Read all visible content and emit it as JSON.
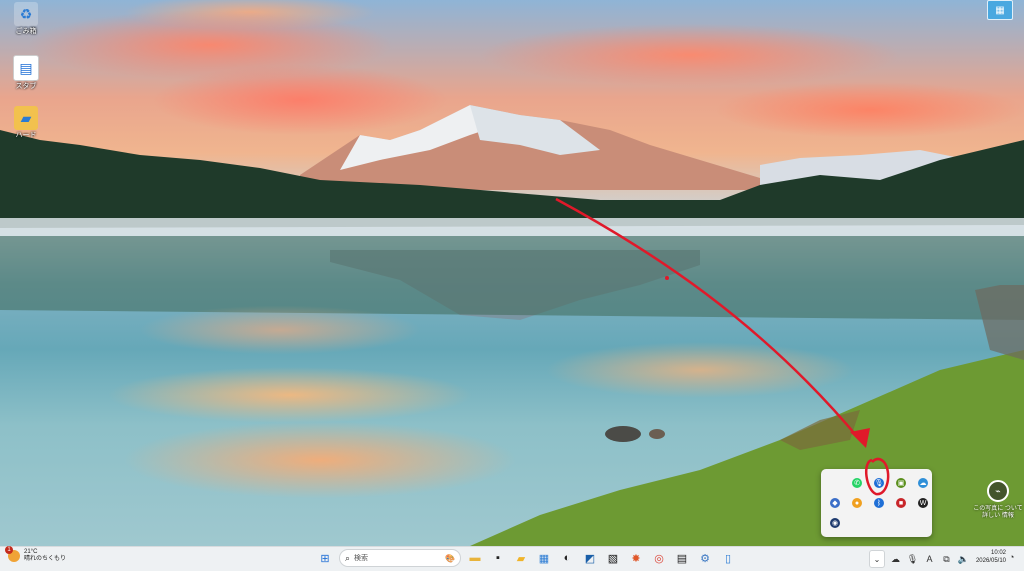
{
  "desktop": {
    "icons": [
      {
        "label": "ごみ箱",
        "icon": "recycle-bin-icon"
      },
      {
        "label": "スタブ",
        "icon": "document-icon"
      },
      {
        "label": "ハード",
        "icon": "folder-icon"
      }
    ],
    "corner_widget_icon": "widget-icon"
  },
  "tray_popup": {
    "items": [
      {
        "icon": "blank-icon",
        "glyph": "",
        "color": "#f3f3f3"
      },
      {
        "icon": "whatsapp-icon",
        "glyph": "✆",
        "color": "#25d366"
      },
      {
        "icon": "microphone-icon",
        "glyph": "🎙",
        "color": "#1f6fd6"
      },
      {
        "icon": "nvidia-icon",
        "glyph": "▣",
        "color": "#5a8f1c"
      },
      {
        "icon": "onedrive-icon",
        "glyph": "☁",
        "color": "#2f8fd8"
      },
      {
        "icon": "security-icon",
        "glyph": "◆",
        "color": "#3b6ec8"
      },
      {
        "icon": "location-icon",
        "glyph": "●",
        "color": "#f0a020"
      },
      {
        "icon": "bluetooth-icon",
        "glyph": "ᛒ",
        "color": "#1f6fd6"
      },
      {
        "icon": "app-red-icon",
        "glyph": "■",
        "color": "#c8262a"
      },
      {
        "icon": "w-app-icon",
        "glyph": "W",
        "color": "#222222"
      },
      {
        "icon": "circle-app-icon",
        "glyph": "◉",
        "color": "#1e3a6e"
      }
    ]
  },
  "activate_notice": {
    "icon": "activation-icon",
    "text": "この写真に ついて詳しい 情報"
  },
  "taskbar": {
    "weather": {
      "temp": "21°C",
      "condition": "晴れのちくもり",
      "badge": "1"
    },
    "search_placeholder": "検索",
    "apps": [
      {
        "icon": "start-icon",
        "glyph": "⊞",
        "color": "#1f6fd6"
      },
      {
        "icon": "file-explorer-icon",
        "glyph": "▬",
        "color": "#e8b33a"
      },
      {
        "icon": "terminal-icon",
        "glyph": "▪",
        "color": "#222222"
      },
      {
        "icon": "folder-icon",
        "glyph": "▰",
        "color": "#f0b429"
      },
      {
        "icon": "store-icon",
        "glyph": "▦",
        "color": "#2a7bd4"
      },
      {
        "icon": "app-dark-icon",
        "glyph": "◐",
        "color": "#222222"
      },
      {
        "icon": "photos-icon",
        "glyph": "◩",
        "color": "#1a5fa8"
      },
      {
        "icon": "pixel-app-icon",
        "glyph": "▧",
        "color": "#111111"
      },
      {
        "icon": "burst-app-icon",
        "glyph": "✸",
        "color": "#e0582a"
      },
      {
        "icon": "chrome-icon",
        "glyph": "◎",
        "color": "#db4437"
      },
      {
        "icon": "notes-icon",
        "glyph": "▤",
        "color": "#222222"
      },
      {
        "icon": "settings-icon",
        "glyph": "⚙",
        "color": "#3a77c2"
      },
      {
        "icon": "phone-link-icon",
        "glyph": "▯",
        "color": "#2a7bd4"
      }
    ],
    "tray": [
      {
        "icon": "chevron-up-icon",
        "glyph": "⌄"
      },
      {
        "icon": "cloud-icon",
        "glyph": "☁"
      },
      {
        "icon": "mic-icon",
        "glyph": "🎙"
      },
      {
        "icon": "ime-icon",
        "glyph": "A"
      },
      {
        "icon": "display-icon",
        "glyph": "⧉"
      },
      {
        "icon": "volume-icon",
        "glyph": "🔈"
      }
    ],
    "time": "10:02",
    "date": "2026/05/10",
    "notification_icon": "notification-icon"
  }
}
